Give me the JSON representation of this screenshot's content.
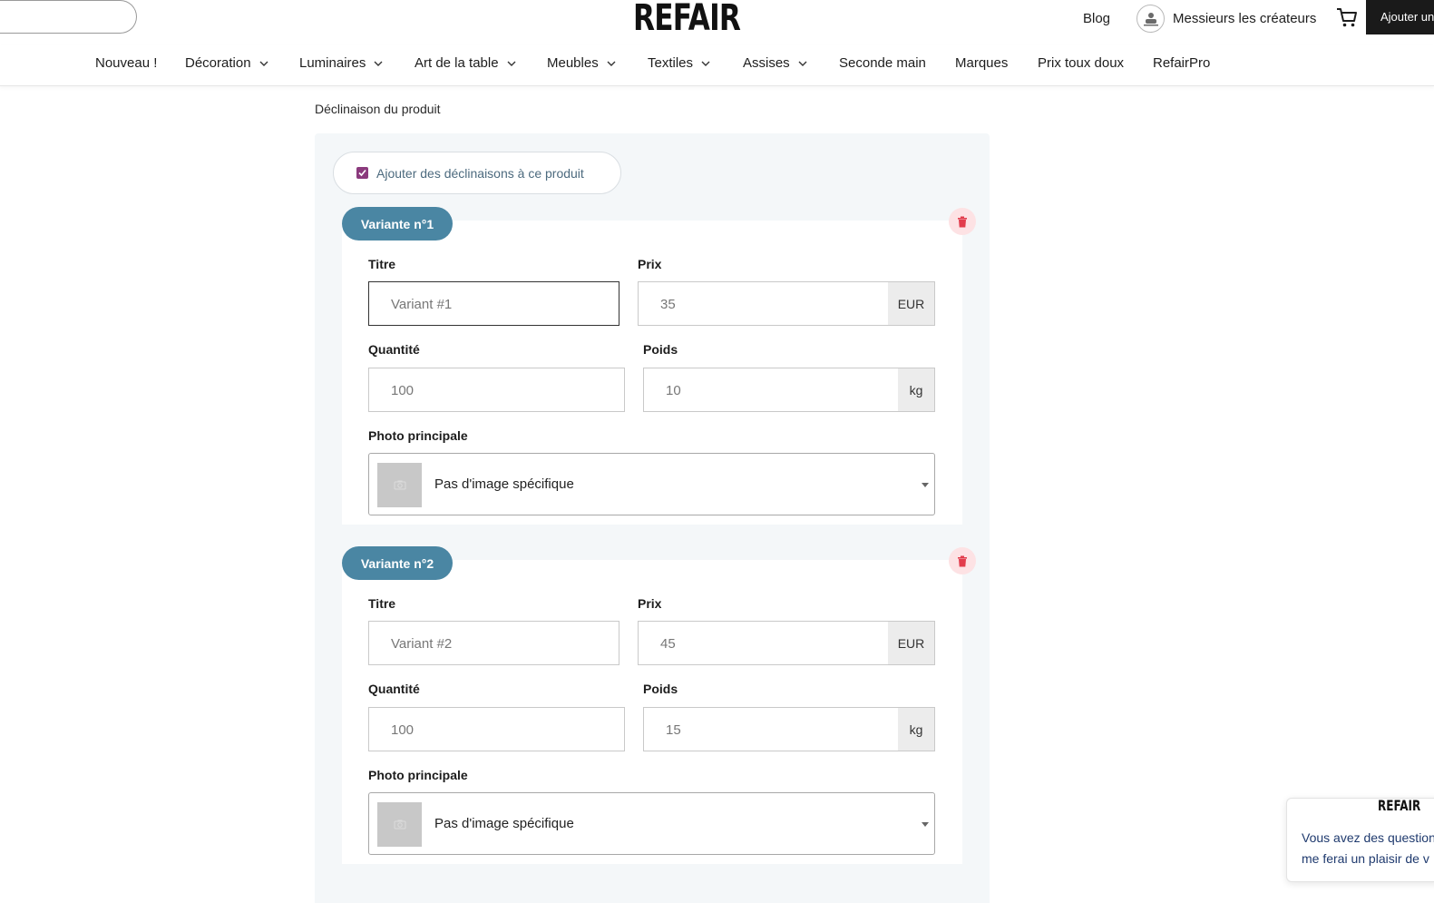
{
  "header": {
    "logo": "REFAIR",
    "blog": "Blog",
    "account_name": "Messieurs les créateurs",
    "add_button": "Ajouter un",
    "icons": [
      "avatar",
      "cart-icon"
    ]
  },
  "nav": [
    {
      "label": "Nouveau !",
      "dropdown": false
    },
    {
      "label": "Décoration",
      "dropdown": true
    },
    {
      "label": "Luminaires",
      "dropdown": true
    },
    {
      "label": "Art de la table",
      "dropdown": true
    },
    {
      "label": "Meubles",
      "dropdown": true
    },
    {
      "label": "Textiles",
      "dropdown": true
    },
    {
      "label": "Assises",
      "dropdown": true
    },
    {
      "label": "Seconde main",
      "dropdown": false
    },
    {
      "label": "Marques",
      "dropdown": false
    },
    {
      "label": "Prix toux doux",
      "dropdown": false
    },
    {
      "label": "RefairPro",
      "dropdown": false
    }
  ],
  "section": {
    "title": "Déclinaison du produit",
    "add_variants_label": "Ajouter des déclinaisons à ce produit",
    "add_variants_checked": true
  },
  "labels": {
    "title": "Titre",
    "price": "Prix",
    "quantity": "Quantité",
    "weight": "Poids",
    "photo": "Photo principale",
    "currency": "EUR",
    "weight_unit": "kg"
  },
  "variants": [
    {
      "badge": "Variante n°1",
      "title_placeholder": "Variant #1",
      "price": "35",
      "quantity": "100",
      "weight": "10",
      "photo": "Pas d'image spécifique"
    },
    {
      "badge": "Variante n°2",
      "title_placeholder": "Variant #2",
      "price": "45",
      "quantity": "100",
      "weight": "15",
      "photo": "Pas d'image spécifique"
    }
  ],
  "chat": {
    "logo": "REFAIR",
    "line1": "Vous avez des questions",
    "line2": "me ferai un plaisir de v"
  },
  "colors": {
    "accent_badge": "#4a86a3",
    "checkbox": "#8b3a7d",
    "panel_bg": "#f4f7f9",
    "trash_bg": "#fde2e4",
    "trash_icon": "#e23c4c"
  }
}
